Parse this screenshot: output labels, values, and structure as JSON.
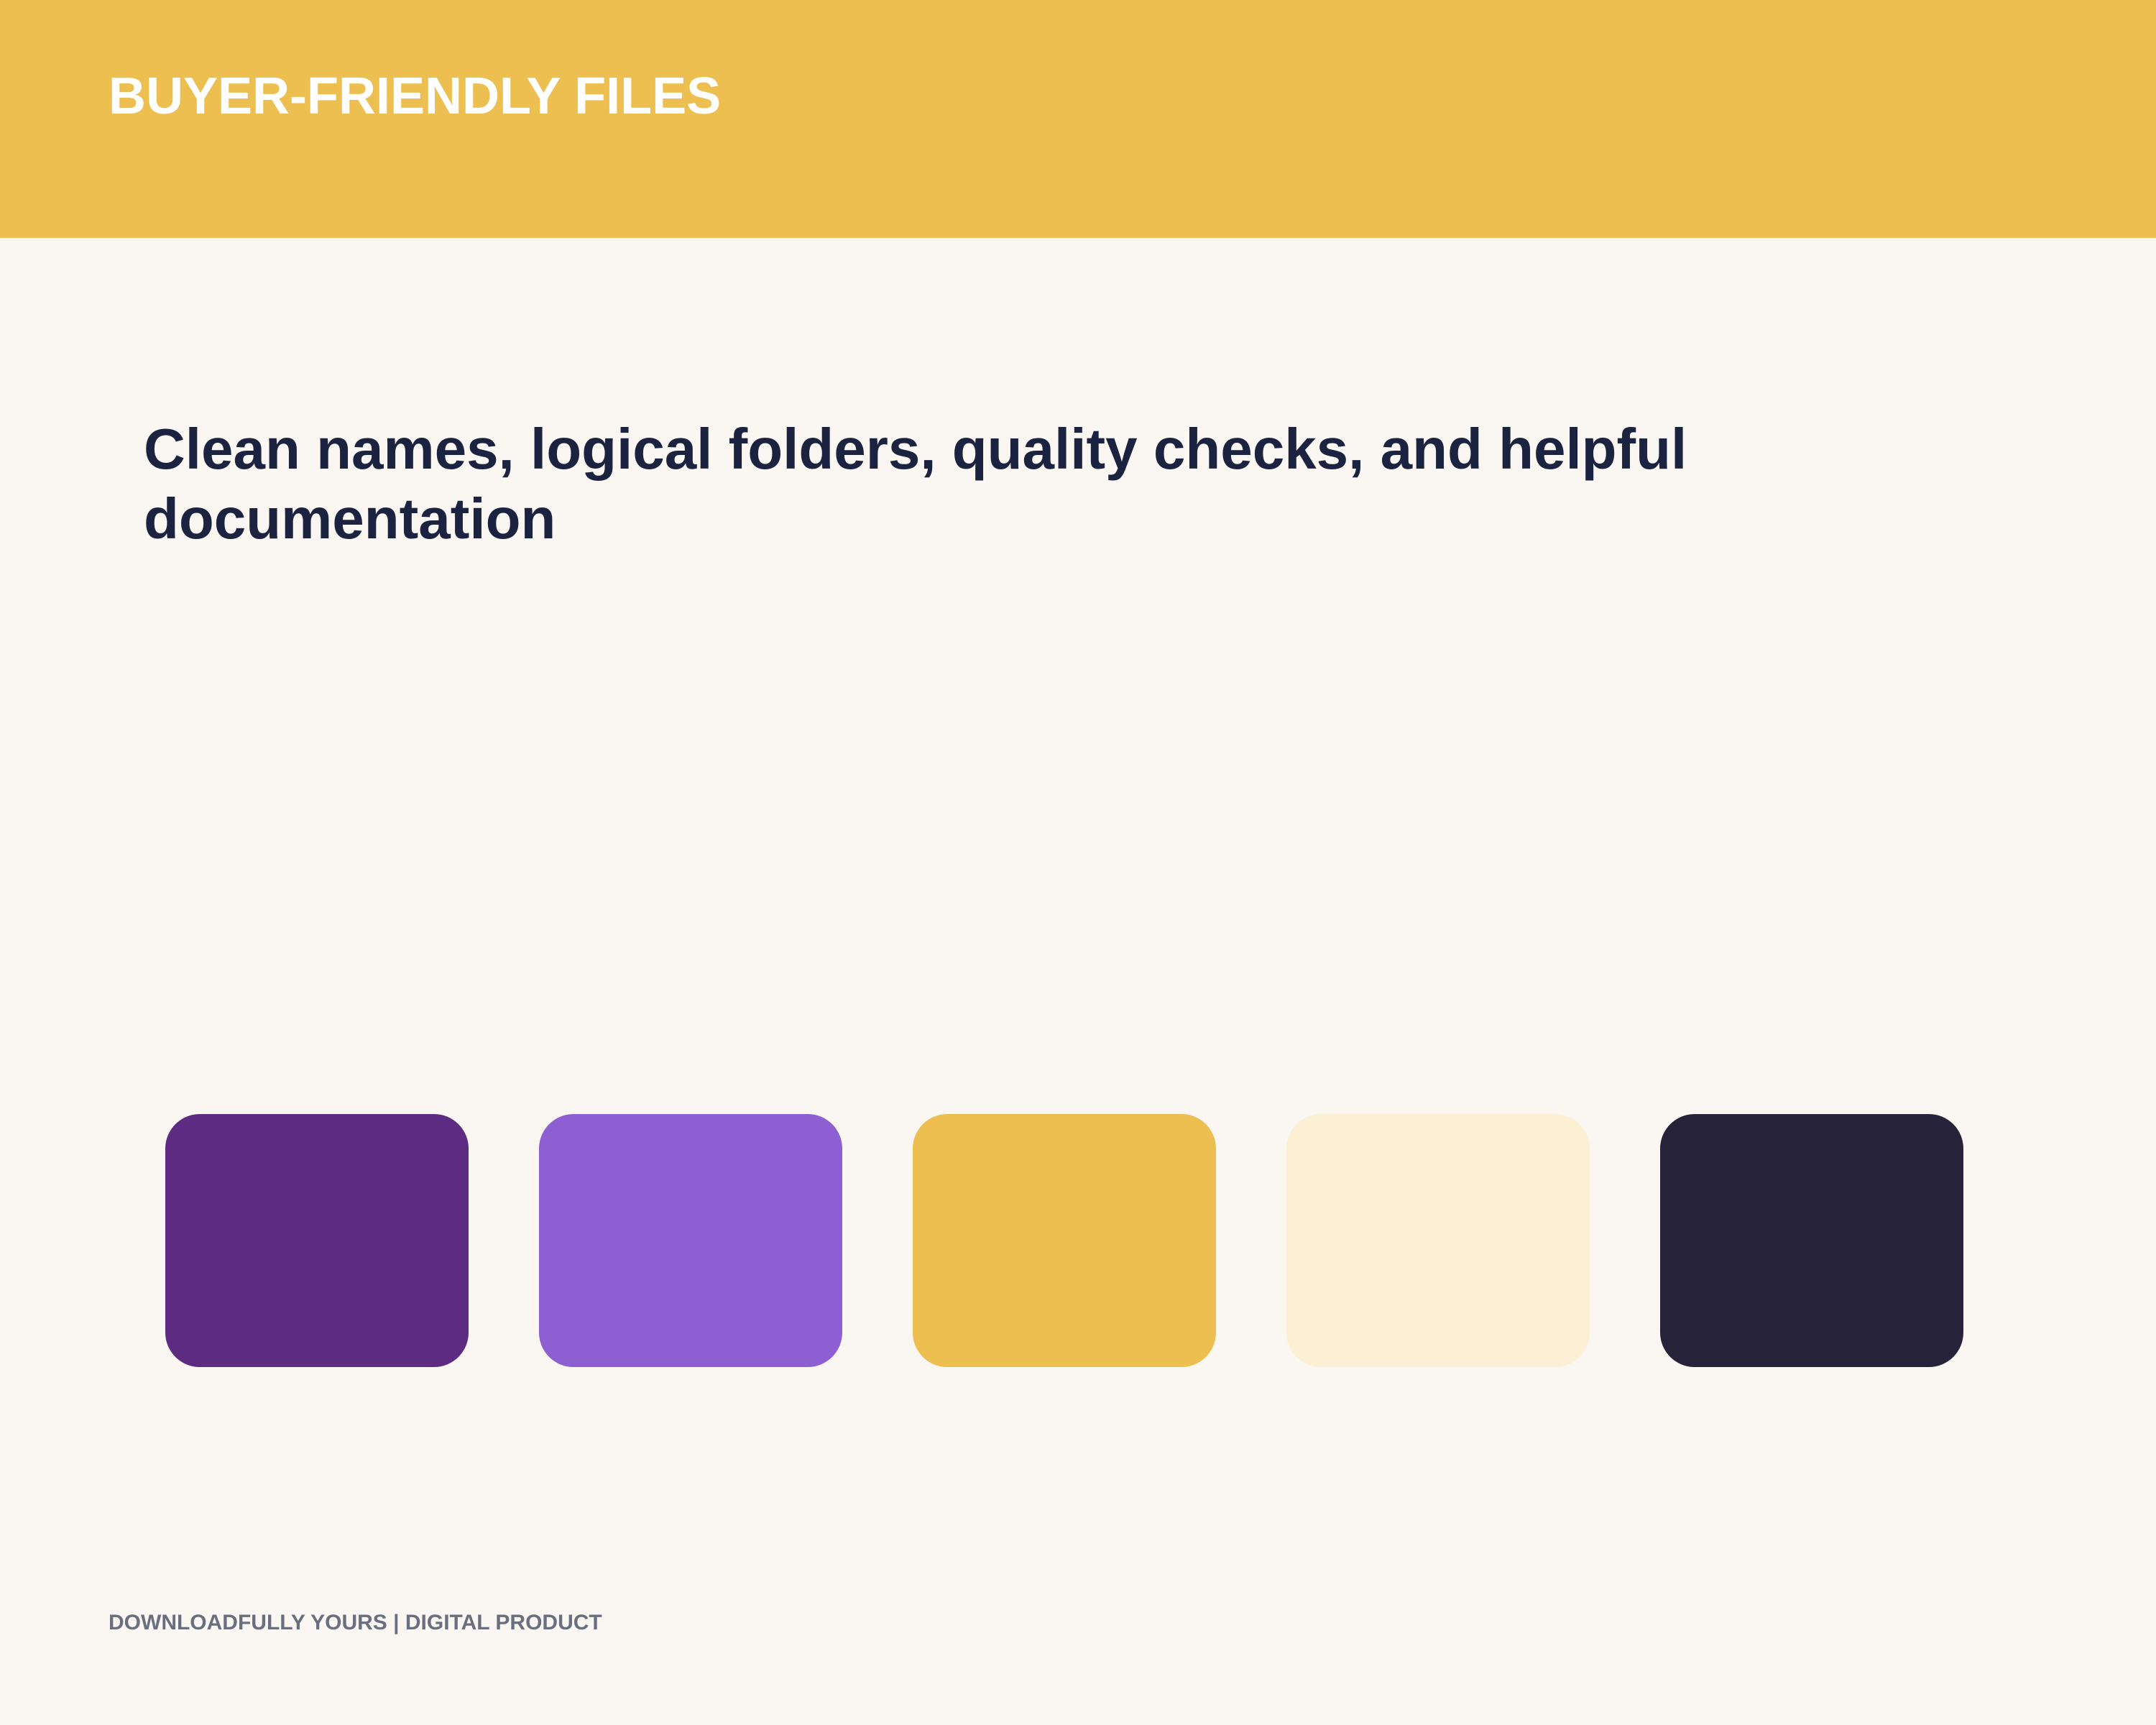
{
  "header": {
    "title": "BUYER-FRIENDLY FILES"
  },
  "headline": "Clean names, logical folders, quality checks, and helpful documentation",
  "palette": {
    "swatches": [
      "#5E2B82",
      "#8E5FD3",
      "#EDBE50",
      "#FBF0D4",
      "#26223A"
    ]
  },
  "footer": {
    "text": "DOWNLOADFULLY YOURS | DIGITAL PRODUCT"
  },
  "colors": {
    "background": "#FAF6F1",
    "header_band": "#EDBE50",
    "header_text": "#FFFFFF",
    "headline_text": "#1C2340",
    "footer_text": "#6A6F80"
  }
}
